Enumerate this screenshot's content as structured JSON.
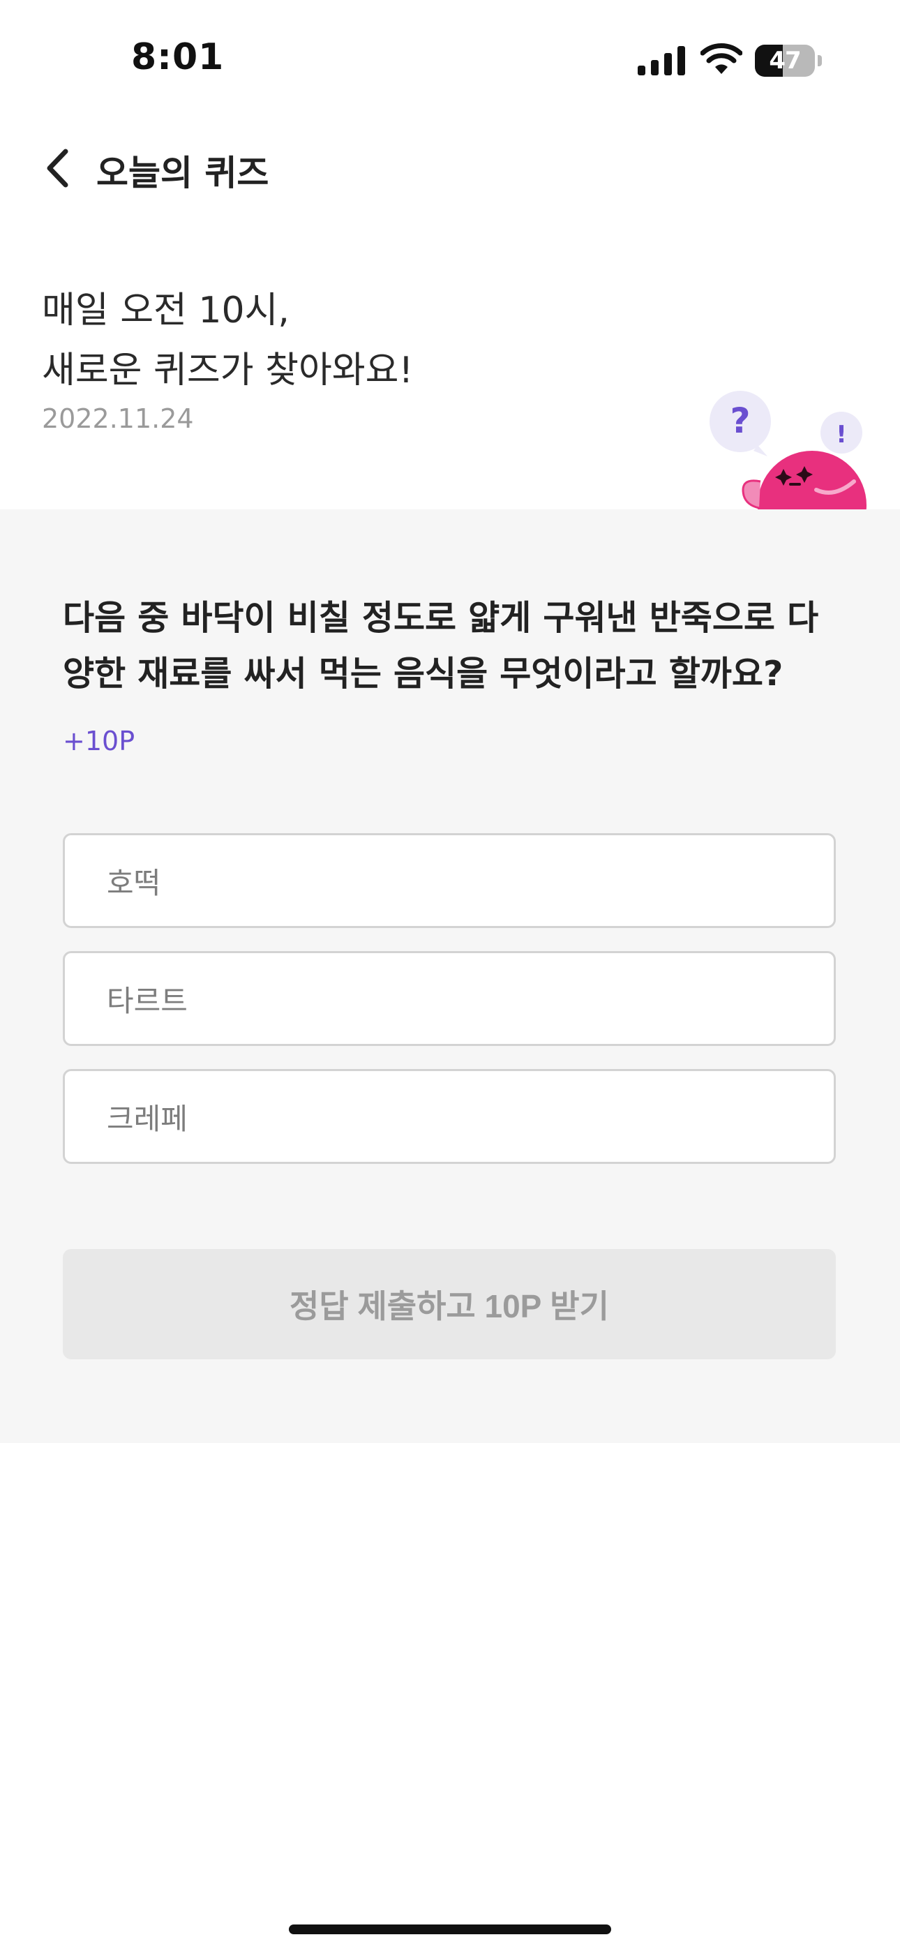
{
  "status_bar": {
    "time": "8:01",
    "battery_level": "47",
    "battery_fraction": 0.47
  },
  "nav": {
    "back_icon": "chevron-left-icon",
    "title": "오늘의 퀴즈"
  },
  "header": {
    "headline_line1": "매일 오전 10시,",
    "headline_line2": "새로운 퀴즈가 찾아와요!",
    "date": "2022.11.24",
    "mascot_question_mark": "?",
    "mascot_exclamation": "!"
  },
  "quiz": {
    "question": "다음 중 바닥이 비칠 정도로 얇게 구워낸 반죽으로 다양한 재료를 싸서 먹는 음식을 무엇이라고 할까요?",
    "points": "+10P",
    "options": [
      "호떡",
      "타르트",
      "크레페"
    ],
    "submit_label": "정답 제출하고 10P 받기"
  },
  "colors": {
    "accent_purple": "#6a4fd0",
    "mascot_pink": "#e8307e",
    "panel_bg": "#f6f6f6",
    "button_disabled_bg": "#e8e8e8"
  }
}
